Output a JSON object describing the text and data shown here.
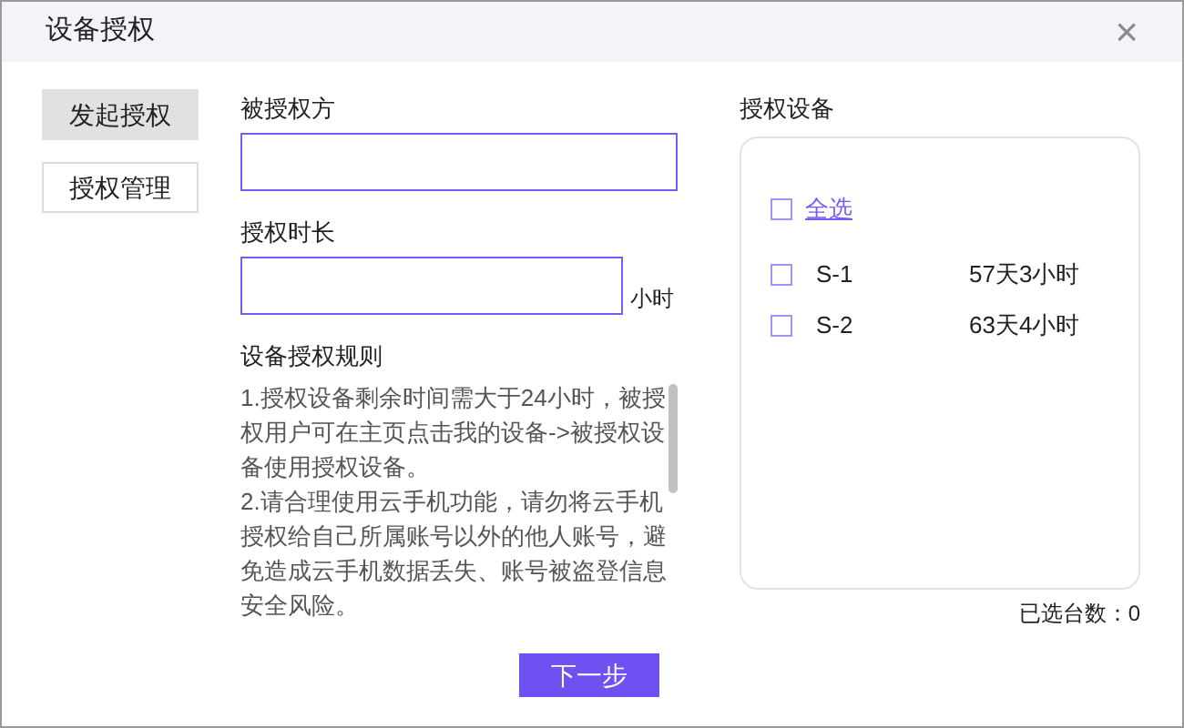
{
  "window": {
    "title": "设备授权",
    "close": "×"
  },
  "nav": [
    {
      "label": "发起授权",
      "selected": true
    },
    {
      "label": "授权管理",
      "selected": false
    }
  ],
  "form": {
    "grantee_label": "被授权方",
    "duration_label": "授权时长",
    "duration_unit": "小时",
    "rules_title": "设备授权规则",
    "rules": [
      "1.授权设备剩余时间需大于24小时，被授权用户可在主页点击我的设备->被授权设备使用授权设备。",
      "2.请合理使用云手机功能，请勿将云手机授权给自己所属账号以外的他人账号，避免造成云手机数据丢失、账号被盗登信息安全风险。"
    ]
  },
  "devices": {
    "title": "授权设备",
    "select_all": {
      "label": "全选",
      "checked": false
    },
    "items": [
      {
        "name": "S-1",
        "remaining": "57天3小时",
        "checked": false
      },
      {
        "name": "S-2",
        "remaining": "63天4小时",
        "checked": false
      }
    ],
    "count": "已选台数：0"
  },
  "next_button": "下一步"
}
